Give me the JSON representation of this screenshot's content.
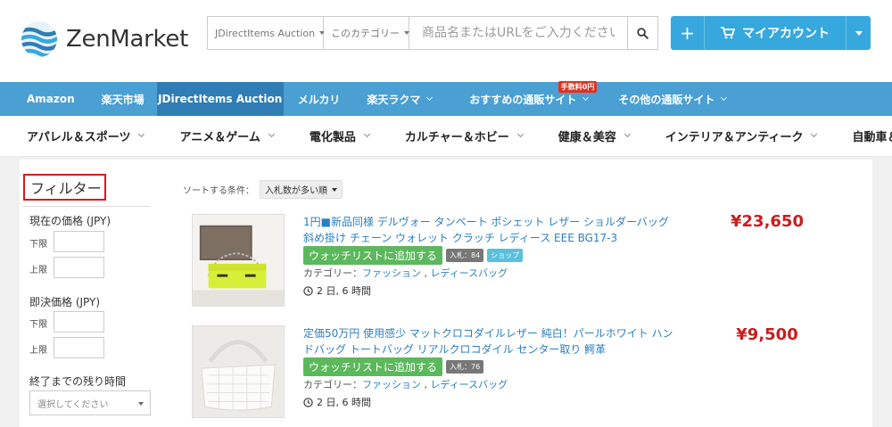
{
  "logo": {
    "text": "ZenMarket"
  },
  "search": {
    "site_select": "JDirectItems Auction",
    "category_select": "このカテゴリー",
    "placeholder": "商品名またはURLをご入力ください"
  },
  "account": {
    "plus": "+",
    "label": "マイアカウント"
  },
  "nav": {
    "items": [
      {
        "label": "Amazon"
      },
      {
        "label": "楽天市場"
      },
      {
        "label": "JDirectItems Auction"
      },
      {
        "label": "メルカリ"
      },
      {
        "label": "楽天ラクマ"
      },
      {
        "label": "おすすめの通販サイト",
        "badge": "手数料0円"
      },
      {
        "label": "その他の通販サイト"
      }
    ]
  },
  "categories": [
    "アパレル＆スポーツ",
    "アニメ＆ゲーム",
    "電化製品",
    "カルチャー＆ホビー",
    "健康＆美容",
    "インテリア＆アンティーク",
    "自動車＆バイク"
  ],
  "filter": {
    "title": "フィルター",
    "current_price": "現在の価格 (JPY)",
    "instant_price": "即決価格 (JPY)",
    "min": "下限",
    "max": "上限",
    "time_left": "終了までの残り時間",
    "time_select": "選択してください"
  },
  "sort": {
    "label": "ソートする条件：",
    "value": "入札数が多い順"
  },
  "items": [
    {
      "title": "1円■新品同様 デルヴォー タンペート ポシェット レザー ショルダーバッグ 斜め掛け チェーン ウォレット クラッチ レディース EEE BG17-3",
      "price": "¥23,650",
      "watch": "ウォッチリストに追加する",
      "bids": "入札：84",
      "shop": "ショップ",
      "category_label": "カテゴリー：",
      "cat1": "ファッション",
      "cat2": "レディースバッグ",
      "time": "2 日, 6 時間"
    },
    {
      "title": "定価50万円 使用感少 マットクロコダイルレザー 純白！パールホワイト ハンドバッグ トートバッグ リアルクロコダイル センター取り 鰐革",
      "price": "¥9,500",
      "watch": "ウォッチリストに追加する",
      "bids": "入札：76",
      "category_label": "カテゴリー：",
      "cat1": "ファッション",
      "cat2": "レディースバッグ",
      "time": "2 日, 6 時間"
    }
  ],
  "colors": {
    "nav_blue": "#4a9fd3",
    "account_blue": "#37a8dd",
    "price_red": "#c81d1d",
    "watch_green": "#5cb85c"
  }
}
